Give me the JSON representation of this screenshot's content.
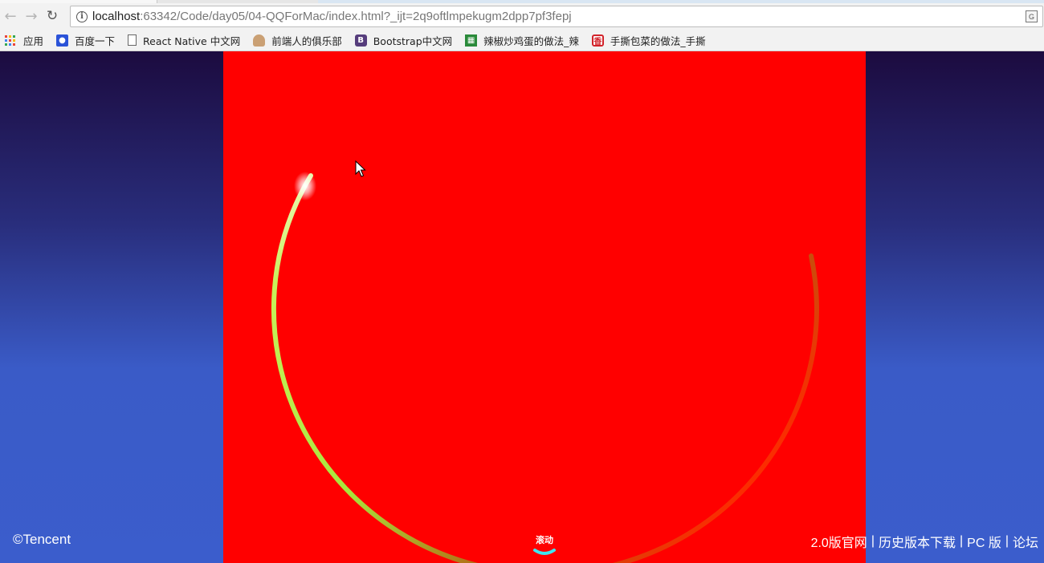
{
  "browser": {
    "address_bar": {
      "host": "localhost",
      "rest": ":63342/Code/day05/04-QQForMac/index.html?_ijt=2q9oftlmpekugm2dpp7pf3fepj"
    },
    "bookmarks": [
      {
        "label": "应用",
        "icon": "apps-grid-icon"
      },
      {
        "label": "百度一下",
        "icon": "baidu-paw-icon"
      },
      {
        "label": "React Native 中文网",
        "icon": "document-icon"
      },
      {
        "label": "前端人的俱乐部",
        "icon": "person-icon"
      },
      {
        "label": "Bootstrap中文网",
        "icon": "bootstrap-icon"
      },
      {
        "label": "辣椒炒鸡蛋的做法_辣",
        "icon": "recipe-icon"
      },
      {
        "label": "手撕包菜的做法_手撕",
        "icon": "xiang-icon"
      }
    ]
  },
  "page": {
    "colors": {
      "stage": "#ff0000",
      "ring_start": "#ffffff",
      "ring_mid": "#a8e63c",
      "ring_end": "#ff2a00"
    },
    "footer": {
      "copyright": "©Tencent",
      "links": [
        "2.0版官网",
        "历史版本下载",
        "PC 版",
        "论坛"
      ],
      "separator": "|"
    },
    "scroll_hint": "滚动"
  }
}
